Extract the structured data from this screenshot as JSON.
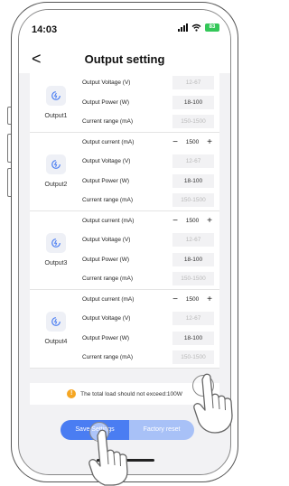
{
  "status_bar": {
    "time": "14:03",
    "battery": "83"
  },
  "header": {
    "back_label": "<",
    "title": "Output setting"
  },
  "outputs": [
    {
      "name": "Output1",
      "rows": [
        {
          "label": "Output Voltage (V)",
          "value": "12-67",
          "kind": "muted"
        },
        {
          "label": "Output Power (W)",
          "value": "18-100",
          "kind": "dark"
        },
        {
          "label": "Current range (mA)",
          "value": "150-1500",
          "kind": "muted"
        }
      ]
    },
    {
      "name": "Output2",
      "rows": [
        {
          "label": "Output current (mA)",
          "value": "1500",
          "kind": "stepper"
        },
        {
          "label": "Output Voltage (V)",
          "value": "12-67",
          "kind": "muted"
        },
        {
          "label": "Output Power (W)",
          "value": "18-100",
          "kind": "dark"
        },
        {
          "label": "Current range (mA)",
          "value": "150-1500",
          "kind": "muted"
        }
      ]
    },
    {
      "name": "Output3",
      "rows": [
        {
          "label": "Output current (mA)",
          "value": "1500",
          "kind": "stepper"
        },
        {
          "label": "Output Voltage (V)",
          "value": "12-67",
          "kind": "muted"
        },
        {
          "label": "Output Power (W)",
          "value": "18-100",
          "kind": "dark"
        },
        {
          "label": "Current range (mA)",
          "value": "150-1500",
          "kind": "muted"
        }
      ]
    },
    {
      "name": "Output4",
      "rows": [
        {
          "label": "Output current (mA)",
          "value": "1500",
          "kind": "stepper"
        },
        {
          "label": "Output Voltage (V)",
          "value": "12-67",
          "kind": "muted"
        },
        {
          "label": "Output Power (W)",
          "value": "18-100",
          "kind": "dark"
        },
        {
          "label": "Current range (mA)",
          "value": "150-1500",
          "kind": "muted"
        }
      ]
    }
  ],
  "stepper_symbols": {
    "minus": "−",
    "plus": "+"
  },
  "notice": {
    "icon": "!",
    "text": "The total load should not exceed:100W"
  },
  "buttons": {
    "save": "Save Settings",
    "reset": "Factory reset"
  },
  "colors": {
    "accent": "#4a7df2",
    "accent_light": "#a8c1f7",
    "warning": "#f5a623"
  }
}
